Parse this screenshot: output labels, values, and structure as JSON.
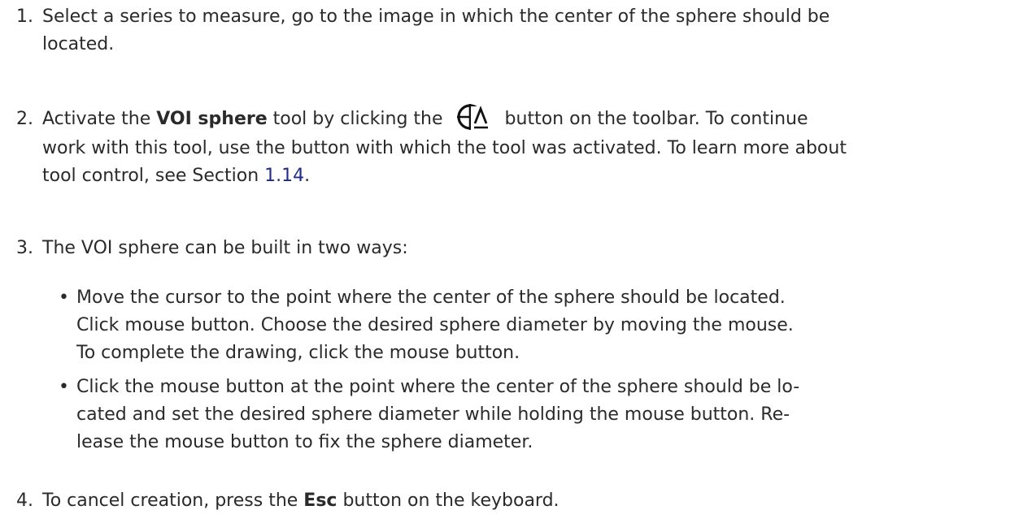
{
  "steps": {
    "s1": {
      "num": "1.",
      "line1": "Select a series to measure, go to the image in which the center of the sphere should be",
      "line2": "located."
    },
    "s2": {
      "num": "2.",
      "prefix": "Activate the ",
      "bold": "VOI sphere",
      "mid": " tool by clicking the",
      "after_icon": "button on the toolbar. To continue",
      "line2": "work with this tool, use the button with which the tool was activated. To learn more about",
      "line3_prefix": "tool control, see Section ",
      "line3_ref": "1.14",
      "line3_suffix": ".",
      "icon": "voi-sphere-tool-icon"
    },
    "s3": {
      "num": "3.",
      "text": "The VOI sphere can be built in two ways:",
      "bullets": [
        {
          "dot": "•",
          "lines": [
            "Move the cursor to the point where the center of the sphere should be located.",
            "Click mouse button. Choose the desired sphere diameter by moving the mouse.",
            "To complete the drawing, click the mouse button."
          ]
        },
        {
          "dot": "•",
          "lines": [
            "Click the mouse button at the point where the center of the sphere should be lo-",
            "cated and set the desired sphere diameter while holding the mouse button. Re-",
            "lease the mouse button to fix the sphere diameter."
          ]
        }
      ]
    },
    "s4": {
      "num": "4.",
      "prefix": "To cancel creation, press the ",
      "bold": "Esc",
      "suffix": " button on the keyboard."
    }
  }
}
